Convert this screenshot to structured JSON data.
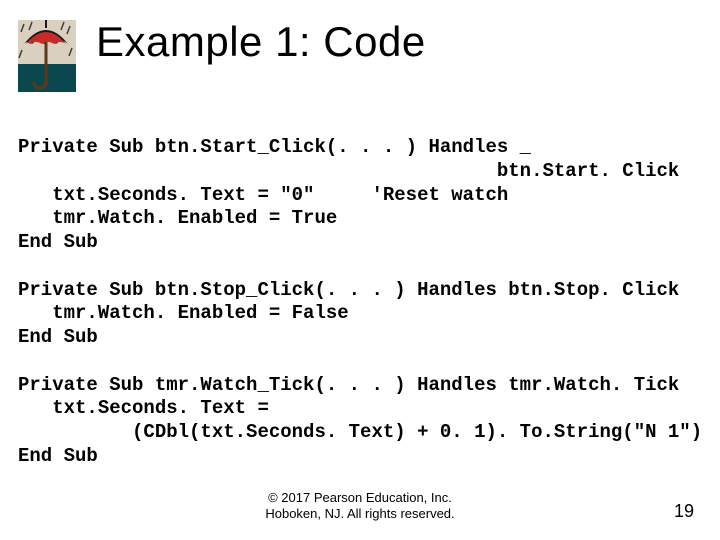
{
  "title": "Example 1: Code",
  "code": "Private Sub btn.Start_Click(. . . ) Handles _\n                                          btn.Start. Click\n   txt.Seconds. Text = \"0\"     'Reset watch\n   tmr.Watch. Enabled = True\nEnd Sub\n\nPrivate Sub btn.Stop_Click(. . . ) Handles btn.Stop. Click\n   tmr.Watch. Enabled = False\nEnd Sub\n\nPrivate Sub tmr.Watch_Tick(. . . ) Handles tmr.Watch. Tick\n   txt.Seconds. Text =\n          (CDbl(txt.Seconds. Text) + 0. 1). To.String(\"N 1\")\nEnd Sub",
  "footer_line1": "© 2017 Pearson Education, Inc.",
  "footer_line2": "Hoboken, NJ. All rights reserved.",
  "page_number": "19",
  "logo": {
    "umbrella_fill": "#c62b2a",
    "umbrella_dark": "#1a1a1a",
    "bg_sky": "#d9d0bf",
    "bg_ground": "#0a474f",
    "handle": "#5a3a1a",
    "raindrop": "#3a3a3a"
  }
}
